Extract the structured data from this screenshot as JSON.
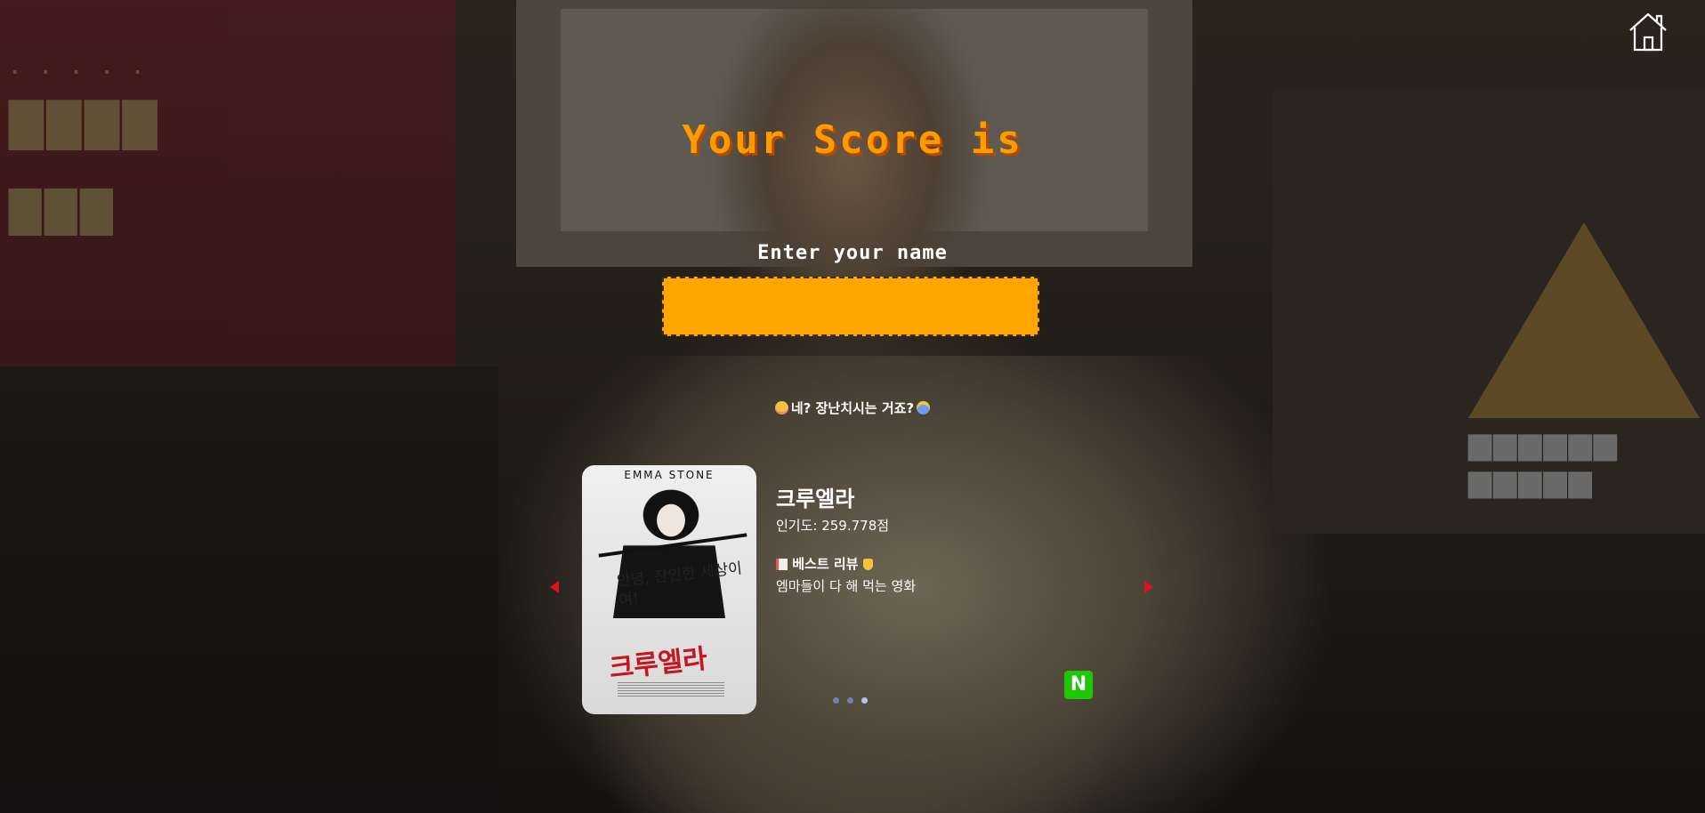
{
  "home": {
    "icon": "home-icon"
  },
  "result": {
    "title": "Your Score is",
    "name_label": "Enter your name",
    "name_input_value": "",
    "name_input_placeholder": "",
    "warning_text": "네? 장난치시는 거죠?",
    "warning_icons": [
      "flushed-face-icon",
      "screaming-face-icon"
    ]
  },
  "movie_card": {
    "poster": {
      "actor": "EMMA STONE",
      "tagline": "안녕, 잔인한 세상이여!",
      "logo_text": "크루엘라"
    },
    "title": "크루엘라",
    "popularity": "인기도: 259.778점",
    "best_review_label": "베스트 리뷰",
    "review_text": "엠마들이 다 해 먹는 영화",
    "naver_badge": "N"
  },
  "carousel": {
    "dot_count": 3,
    "active_index": 2
  },
  "colors": {
    "score_orange": "#ff9a00",
    "input_bg": "#ffa500",
    "arrow_red": "#e0121e",
    "naver_green": "#1ec800"
  }
}
